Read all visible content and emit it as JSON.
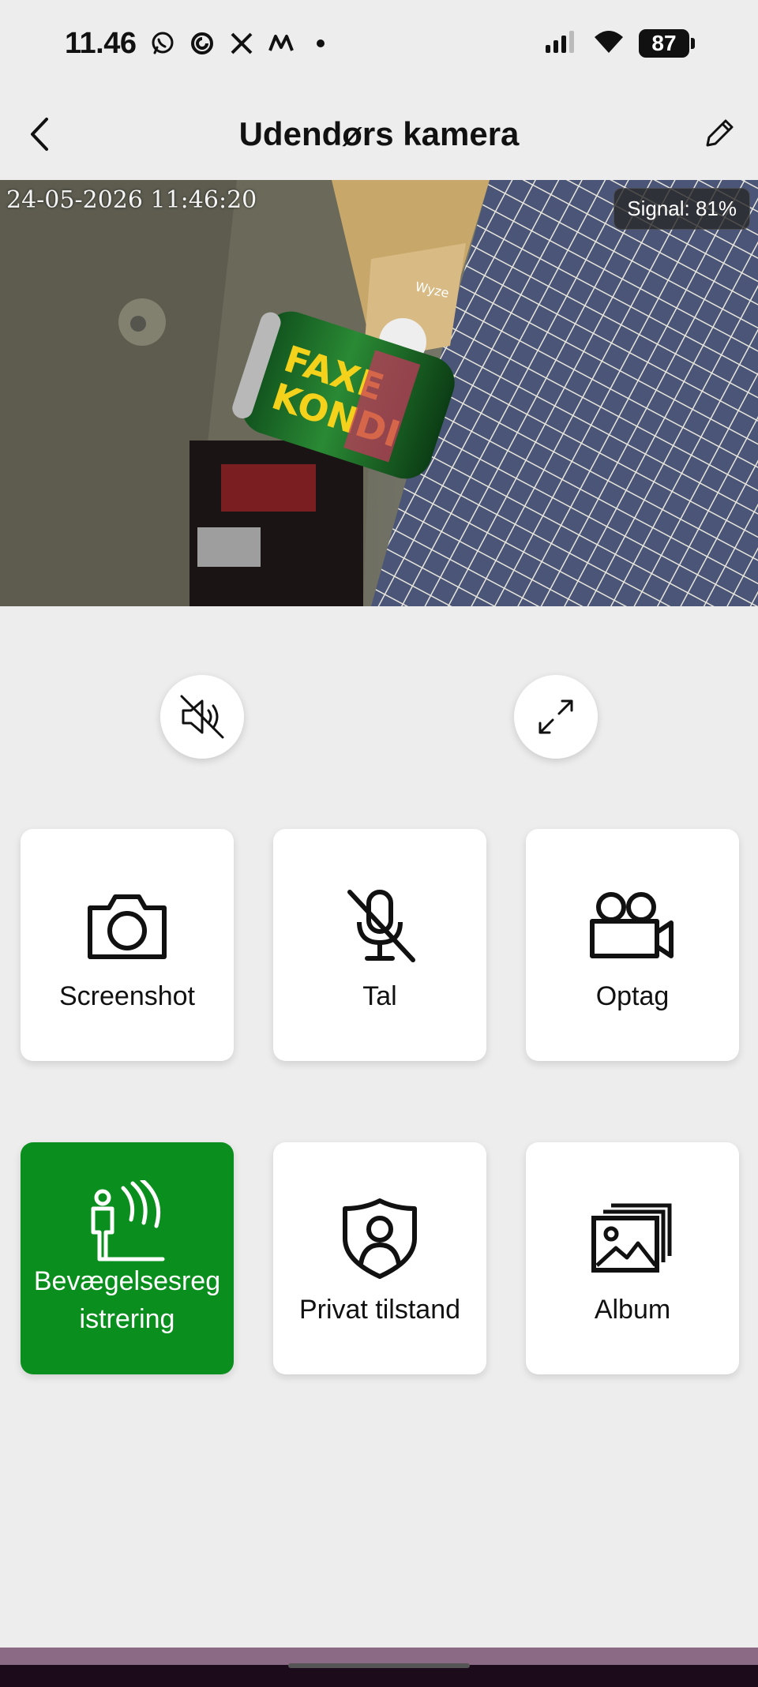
{
  "status_bar": {
    "time": "11.46",
    "battery": "87",
    "notification_icons": [
      "whatsapp-icon",
      "sync-icon",
      "x-icon",
      "threads-icon",
      "dot-icon"
    ]
  },
  "header": {
    "title": "Udendørs kamera"
  },
  "camera": {
    "timestamp": "24-05-2026 11:46:20",
    "signal": "Signal: 81%",
    "can_text_line1": "FAXE",
    "can_text_line2": "KONDI",
    "box_brand": "Wyze"
  },
  "controls": {
    "mute_icon": "speaker-muted-icon",
    "fullscreen_icon": "expand-icon"
  },
  "tiles": [
    {
      "label": "Screenshot",
      "icon": "camera-icon"
    },
    {
      "label": "Tal",
      "icon": "microphone-muted-icon"
    },
    {
      "label": "Optag",
      "icon": "video-camera-icon"
    },
    {
      "label_line1": "Bevægelsesreg",
      "label_line2": "istrering",
      "icon": "motion-detection-icon",
      "active": true
    },
    {
      "label": "Privat tilstand",
      "icon": "privacy-shield-icon"
    },
    {
      "label": "Album",
      "icon": "album-icon"
    }
  ],
  "colors": {
    "active_tile": "#0a8f1e",
    "background": "#ededed",
    "tile": "#ffffff"
  }
}
